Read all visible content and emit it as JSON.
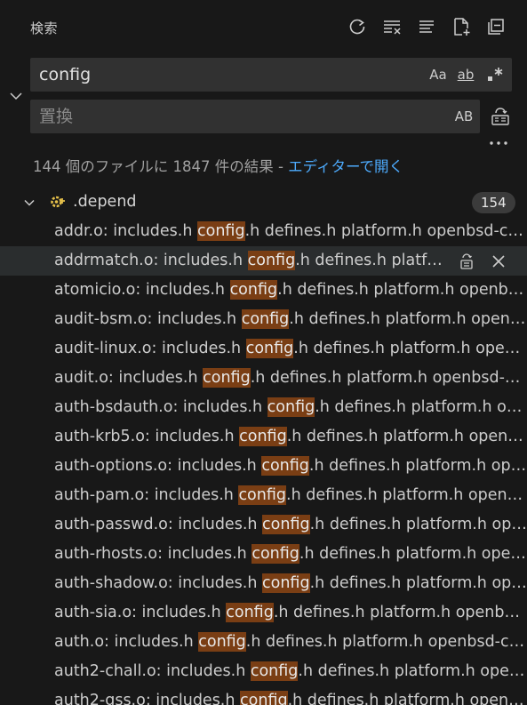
{
  "header": {
    "title": "検索"
  },
  "search": {
    "value": "config",
    "options": {
      "match_case": "Aa",
      "whole_word": "ab",
      "regex": ".*"
    }
  },
  "replace": {
    "placeholder": "置換",
    "preserve_case": "AB"
  },
  "summary": {
    "text": "144 個のファイルに 1847 件の結果 - ",
    "open_in_editor": "エディターで開く"
  },
  "file_group": {
    "name": ".depend",
    "count": "154"
  },
  "matches": [
    {
      "prefix": "addr.o: includes.h ",
      "match": "config",
      "suffix": ".h defines.h platform.h openbsd-compat/openbsd-compat.h"
    },
    {
      "prefix": "addrmatch.o: includes.h ",
      "match": "config",
      "suffix": ".h defines.h platform.h openbsd-compat/openbsd-compat.h"
    },
    {
      "prefix": "atomicio.o: includes.h ",
      "match": "config",
      "suffix": ".h defines.h platform.h openbsd-compat/openbsd-compat.h"
    },
    {
      "prefix": "audit-bsm.o: includes.h ",
      "match": "config",
      "suffix": ".h defines.h platform.h openbsd-compat/openbsd-compat.h"
    },
    {
      "prefix": "audit-linux.o: includes.h ",
      "match": "config",
      "suffix": ".h defines.h platform.h openbsd-compat/openbsd-compat.h"
    },
    {
      "prefix": "audit.o: includes.h ",
      "match": "config",
      "suffix": ".h defines.h platform.h openbsd-compat/openbsd-compat.h"
    },
    {
      "prefix": "auth-bsdauth.o: includes.h ",
      "match": "config",
      "suffix": ".h defines.h platform.h openbsd-compat/openbsd-compat.h"
    },
    {
      "prefix": "auth-krb5.o: includes.h ",
      "match": "config",
      "suffix": ".h defines.h platform.h openbsd-compat/openbsd-compat.h"
    },
    {
      "prefix": "auth-options.o: includes.h ",
      "match": "config",
      "suffix": ".h defines.h platform.h openbsd-compat/openbsd-compat.h"
    },
    {
      "prefix": "auth-pam.o: includes.h ",
      "match": "config",
      "suffix": ".h defines.h platform.h openbsd-compat/openbsd-compat.h"
    },
    {
      "prefix": "auth-passwd.o: includes.h ",
      "match": "config",
      "suffix": ".h defines.h platform.h openbsd-compat/openbsd-compat.h"
    },
    {
      "prefix": "auth-rhosts.o: includes.h ",
      "match": "config",
      "suffix": ".h defines.h platform.h openbsd-compat/openbsd-compat.h"
    },
    {
      "prefix": "auth-shadow.o: includes.h ",
      "match": "config",
      "suffix": ".h defines.h platform.h openbsd-compat/openbsd-compat.h"
    },
    {
      "prefix": "auth-sia.o: includes.h ",
      "match": "config",
      "suffix": ".h defines.h platform.h openbsd-compat/openbsd-compat.h"
    },
    {
      "prefix": "auth.o: includes.h ",
      "match": "config",
      "suffix": ".h defines.h platform.h openbsd-compat/openbsd-compat.h"
    },
    {
      "prefix": "auth2-chall.o: includes.h ",
      "match": "config",
      "suffix": ".h defines.h platform.h openbsd-compat/openbsd-compat.h"
    },
    {
      "prefix": "auth2-gss.o: includes.h ",
      "match": "config",
      "suffix": ".h defines.h platform.h openbsd-compat/openbsd-compat.h"
    }
  ],
  "icons": {
    "header": [
      "refresh-icon",
      "clear-results-icon",
      "view-as-tree-icon",
      "new-search-editor-icon",
      "collapse-all-icon"
    ],
    "row_actions": [
      "replace-icon",
      "dismiss-icon"
    ]
  },
  "colors": {
    "background": "#181818",
    "input_background": "#313131",
    "match_highlight": "#7a3e14",
    "link": "#4daafc",
    "hover_row": "#2a2d2e",
    "file_icon": "#e5c04a"
  }
}
